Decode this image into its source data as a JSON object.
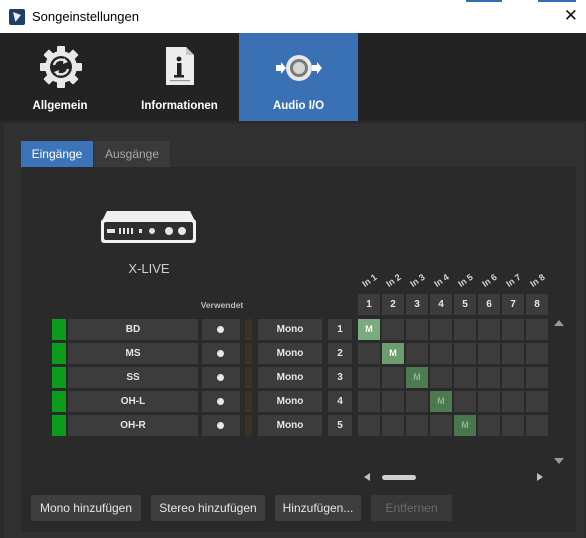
{
  "window": {
    "title": "Songeinstellungen",
    "close_glyph": "✕"
  },
  "main_tabs": [
    {
      "label": "Allgemein",
      "icon": "gear-sync-icon",
      "active": false
    },
    {
      "label": "Informationen",
      "icon": "document-info-icon",
      "active": false
    },
    {
      "label": "Audio I/O",
      "icon": "speaker-io-icon",
      "active": true
    }
  ],
  "sub_tabs": [
    {
      "label": "Eingänge",
      "active": true
    },
    {
      "label": "Ausgänge",
      "active": false
    }
  ],
  "device": {
    "name": "X-LIVE",
    "icon": "audio-interface-icon"
  },
  "table": {
    "used_header": "Verwendet",
    "columns": [
      "In 1",
      "In 2",
      "In 3",
      "In 4",
      "In 5",
      "In 6",
      "In 7",
      "In 8"
    ],
    "column_numbers": [
      "1",
      "2",
      "3",
      "4",
      "5",
      "6",
      "7",
      "8"
    ],
    "rows": [
      {
        "name": "BD",
        "mode": "Mono",
        "number": "1",
        "active_input": 1
      },
      {
        "name": "MS",
        "mode": "Mono",
        "number": "2",
        "active_input": 2
      },
      {
        "name": "SS",
        "mode": "Mono",
        "number": "3",
        "active_input": 3
      },
      {
        "name": "OH-L",
        "mode": "Mono",
        "number": "4",
        "active_input": 4
      },
      {
        "name": "OH-R",
        "mode": "Mono",
        "number": "5",
        "active_input": 5
      }
    ],
    "cell_marker": "M"
  },
  "buttons": {
    "mono": "Mono hinzufügen",
    "stereo": "Stereo hinzufügen",
    "add": "Hinzufügen...",
    "remove": "Entfernen"
  },
  "colors": {
    "accent": "#3b74b9",
    "track_green": "#0c9b1c",
    "matrix_on": "#5d8a5f"
  }
}
